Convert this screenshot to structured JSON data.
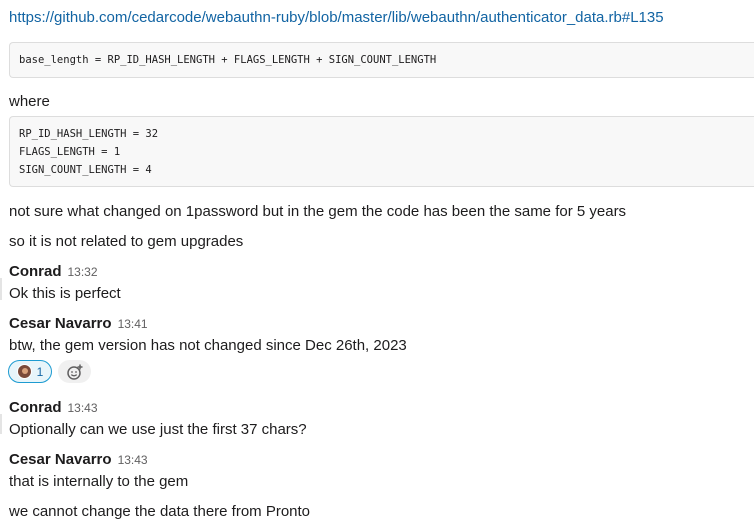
{
  "link": "https://github.com/cedarcode/webauthn-ruby/blob/master/lib/webauthn/authenticator_data.rb#L135",
  "code1": [
    "base_length = RP_ID_HASH_LENGTH + FLAGS_LENGTH + SIGN_COUNT_LENGTH"
  ],
  "where": "where",
  "code2": [
    "RP_ID_HASH_LENGTH = 32",
    "FLAGS_LENGTH = 1",
    "SIGN_COUNT_LENGTH = 4"
  ],
  "msg_a": "not sure what changed on 1password but in the gem the code has been the same for 5 years",
  "msg_b": "so it is not related to gem upgrades",
  "messages": [
    {
      "author": "Conrad",
      "time": "13:32",
      "text": "Ok this is perfect"
    },
    {
      "author": "Cesar Navarro",
      "time": "13:41",
      "text": "btw, the gem version has not changed since Dec 26th, 2023"
    },
    {
      "author": "Conrad",
      "time": "13:43",
      "text": "Optionally can we use just the first 37 chars?"
    },
    {
      "author": "Cesar Navarro",
      "time": "13:43",
      "text": "that is internally to the gem"
    }
  ],
  "reaction": {
    "count": "1",
    "icon": "avatar-icon"
  },
  "msg_last": "we cannot change the data there from Pronto",
  "colors": {
    "link": "#1264a3",
    "reaction_border": "#1d9bd1",
    "timestamp": "#616061"
  }
}
